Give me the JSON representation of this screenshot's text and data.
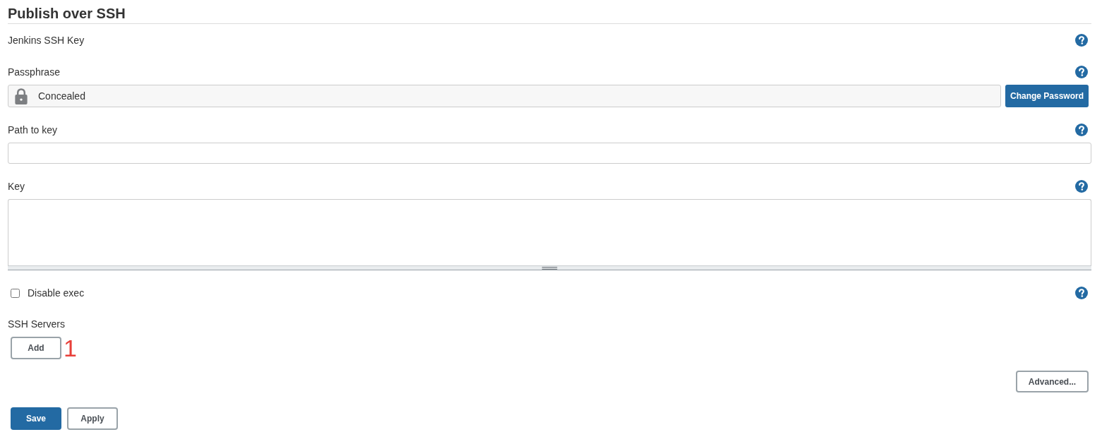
{
  "section": {
    "title": "Publish over SSH"
  },
  "fields": [
    {
      "kind": "label",
      "label": "Jenkins SSH Key"
    },
    {
      "kind": "secret",
      "label": "Passphrase",
      "value": "Concealed",
      "button": "Change Password"
    },
    {
      "kind": "text",
      "label": "Path to key"
    },
    {
      "kind": "textarea",
      "label": "Key"
    },
    {
      "kind": "checkbox",
      "label": "Disable exec",
      "checked": false
    }
  ],
  "ssh_servers": {
    "label": "SSH Servers",
    "add_button": "Add",
    "annotation": "1"
  },
  "advanced_button": "Advanced...",
  "buttons": [
    {
      "label": "Save",
      "kind": "primary"
    },
    {
      "label": "Apply",
      "kind": "secondary"
    }
  ]
}
